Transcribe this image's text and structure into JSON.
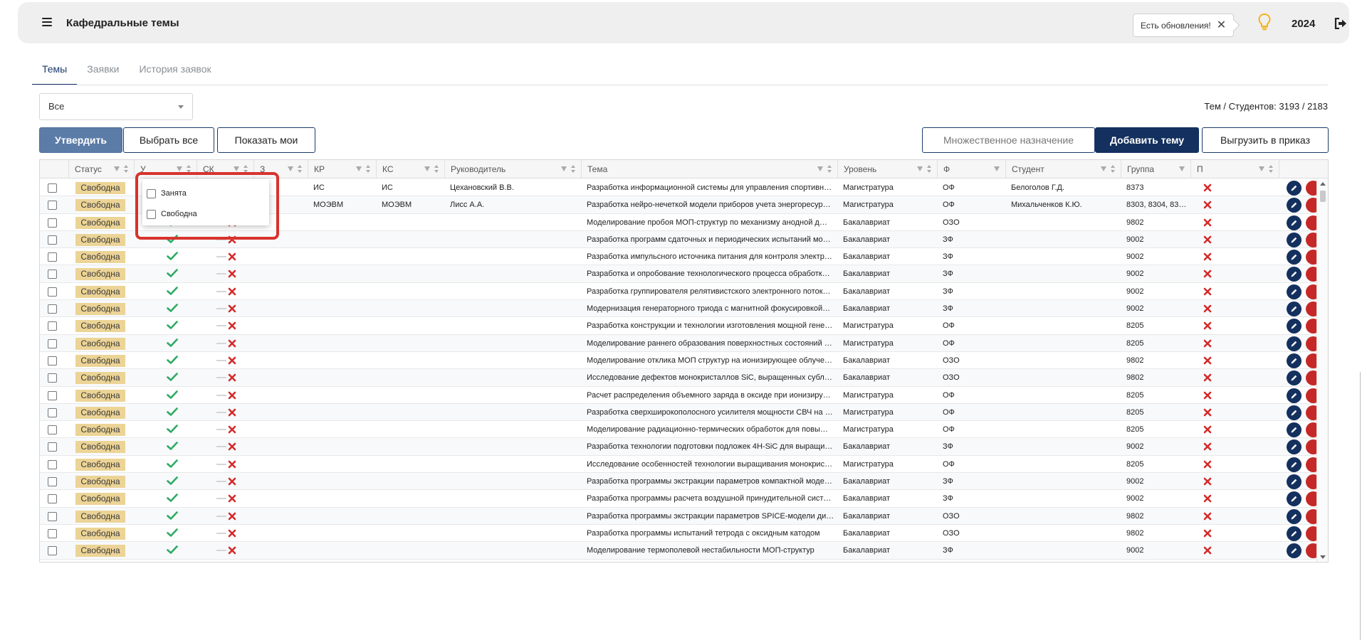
{
  "header": {
    "title": "Кафедральные темы",
    "updates_text": "Есть обновления!",
    "year": "2024"
  },
  "tabs": [
    {
      "label": "Темы",
      "active": true
    },
    {
      "label": "Заявки",
      "active": false
    },
    {
      "label": "История заявок",
      "active": false
    }
  ],
  "filter": {
    "selected": "Все"
  },
  "counter": "Тем / Студентов: 3193 / 2183",
  "toolbar": {
    "approve": "Утвердить",
    "select_all": "Выбрать все",
    "show_mine": "Показать мои",
    "multi_assign": "Множественное назначение",
    "add_topic": "Добавить тему",
    "export_order": "Выгрузить в приказ"
  },
  "columns": [
    "Статус",
    "У",
    "СК",
    "З",
    "КР",
    "КС",
    "Руководитель",
    "Тема",
    "Уровень",
    "Ф",
    "Студент",
    "Группа",
    "П"
  ],
  "popup": {
    "options": [
      "Занята",
      "Свободна"
    ]
  },
  "colors": {
    "accent": "#13305e",
    "badge": "#ecd496",
    "ok": "#2eaa63",
    "no": "#d42a2a"
  },
  "rows": [
    {
      "status": "Свободна",
      "kr": "ИС",
      "ks": "ИС",
      "lead": "Цехановский В.В.",
      "topic": "Разработка информационной системы для управления спортивно…",
      "level": "Магистратура",
      "form": "ОФ",
      "student": "Белоголов Г.Д.",
      "group": "8373"
    },
    {
      "status": "Свободна",
      "kr": "МОЭВМ",
      "ks": "МОЭВМ",
      "lead": "Лисс А.А.",
      "topic": "Разработка нейро-нечеткой модели приборов учета энергоресур…",
      "level": "Магистратура",
      "form": "ОФ",
      "student": "Михальченков К.Ю.",
      "group": "8303, 8304, 830…"
    },
    {
      "status": "Свободна",
      "kr": "",
      "ks": "",
      "lead": "",
      "topic": "Моделирование пробоя МОП-структур по механизму анодной д…",
      "level": "Бакалавриат",
      "form": "ОЗО",
      "student": "",
      "group": "9802"
    },
    {
      "status": "Свободна",
      "kr": "",
      "ks": "",
      "lead": "",
      "topic": "Разработка программ сдаточных и периодических испытаний мо…",
      "level": "Бакалавриат",
      "form": "ЗФ",
      "student": "",
      "group": "9002"
    },
    {
      "status": "Свободна",
      "kr": "",
      "ks": "",
      "lead": "",
      "topic": "Разработка импульсного источника питания для контроля электр…",
      "level": "Бакалавриат",
      "form": "ЗФ",
      "student": "",
      "group": "9002"
    },
    {
      "status": "Свободна",
      "kr": "",
      "ks": "",
      "lead": "",
      "topic": "Разработка и опробование технологического процесса обработк…",
      "level": "Бакалавриат",
      "form": "ЗФ",
      "student": "",
      "group": "9002"
    },
    {
      "status": "Свободна",
      "kr": "",
      "ks": "",
      "lead": "",
      "topic": "Разработка группирователя релятивистского электронного поток…",
      "level": "Бакалавриат",
      "form": "ЗФ",
      "student": "",
      "group": "9002"
    },
    {
      "status": "Свободна",
      "kr": "",
      "ks": "",
      "lead": "",
      "topic": "Модернизация генераторного триода с магнитной фокусировкой…",
      "level": "Бакалавриат",
      "form": "ЗФ",
      "student": "",
      "group": "9002"
    },
    {
      "status": "Свободна",
      "kr": "",
      "ks": "",
      "lead": "",
      "topic": "Разработка конструкции и технологии изготовления мощной гене…",
      "level": "Магистратура",
      "form": "ОФ",
      "student": "",
      "group": "8205"
    },
    {
      "status": "Свободна",
      "kr": "",
      "ks": "",
      "lead": "",
      "topic": "Моделирование раннего образования поверхностных состояний …",
      "level": "Магистратура",
      "form": "ОФ",
      "student": "",
      "group": "8205"
    },
    {
      "status": "Свободна",
      "kr": "",
      "ks": "",
      "lead": "",
      "topic": "Моделирование отклика МОП структур на ионизирующее облуче…",
      "level": "Бакалавриат",
      "form": "ОЗО",
      "student": "",
      "group": "9802"
    },
    {
      "status": "Свободна",
      "kr": "",
      "ks": "",
      "lead": "",
      "topic": "Исследование дефектов монокристаллов SiC, выращенных субли…",
      "level": "Бакалавриат",
      "form": "ОЗО",
      "student": "",
      "group": "9802"
    },
    {
      "status": "Свободна",
      "kr": "",
      "ks": "",
      "lead": "",
      "topic": "Расчет распределения объемного заряда в оксиде при ионизиру…",
      "level": "Магистратура",
      "form": "ОФ",
      "student": "",
      "group": "8205"
    },
    {
      "status": "Свободна",
      "kr": "",
      "ks": "",
      "lead": "",
      "topic": "Разработка сверхширокополосного усилителя мощности СВЧ на т…",
      "level": "Магистратура",
      "form": "ОФ",
      "student": "",
      "group": "8205"
    },
    {
      "status": "Свободна",
      "kr": "",
      "ks": "",
      "lead": "",
      "topic": "Моделирование радиационно-термических обработок для повы…",
      "level": "Магистратура",
      "form": "ОФ",
      "student": "",
      "group": "8205"
    },
    {
      "status": "Свободна",
      "kr": "",
      "ks": "",
      "lead": "",
      "topic": "Разработка технологии подготовки подложек 4H-SiC для выращи…",
      "level": "Бакалавриат",
      "form": "ЗФ",
      "student": "",
      "group": "9002"
    },
    {
      "status": "Свободна",
      "kr": "",
      "ks": "",
      "lead": "",
      "topic": "Исследование особенностей технологии выращивания монокрис…",
      "level": "Магистратура",
      "form": "ОФ",
      "student": "",
      "group": "8205"
    },
    {
      "status": "Свободна",
      "kr": "",
      "ks": "",
      "lead": "",
      "topic": "Разработка программы экстракции параметров компактной моде…",
      "level": "Бакалавриат",
      "form": "ЗФ",
      "student": "",
      "group": "9002"
    },
    {
      "status": "Свободна",
      "kr": "",
      "ks": "",
      "lead": "",
      "topic": "Разработка программы расчета воздушной принудительной сист…",
      "level": "Бакалавриат",
      "form": "ЗФ",
      "student": "",
      "group": "9002"
    },
    {
      "status": "Свободна",
      "kr": "",
      "ks": "",
      "lead": "",
      "topic": "Разработка программы экстракции параметров SPICE-модели ди…",
      "level": "Бакалавриат",
      "form": "ОЗО",
      "student": "",
      "group": "9802"
    },
    {
      "status": "Свободна",
      "kr": "",
      "ks": "",
      "lead": "",
      "topic": "Разработка программы испытаний тетрода с оксидным катодом",
      "level": "Бакалавриат",
      "form": "ОЗО",
      "student": "",
      "group": "9802"
    },
    {
      "status": "Свободна",
      "kr": "",
      "ks": "",
      "lead": "",
      "topic": "Моделирование термополевой нестабильности МОП-структур",
      "level": "Бакалавриат",
      "form": "ЗФ",
      "student": "",
      "group": "9002"
    }
  ]
}
